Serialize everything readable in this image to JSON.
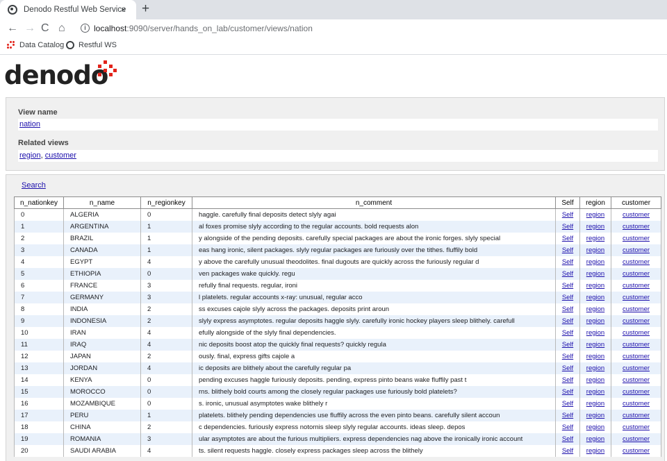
{
  "browser": {
    "tab_title": "Denodo Restful Web Service",
    "tab_close": "×",
    "new_tab": "+",
    "url_host": "localhost",
    "url_rest": ":9090/server/hands_on_lab/customer/views/nation",
    "bookmarks": [
      "Data Catalog",
      "Restful WS"
    ],
    "nav": {
      "back": "←",
      "forward": "→",
      "reload": "C",
      "home": "⌂",
      "info": "i"
    }
  },
  "logo": {
    "text": "denodo",
    "accent_color": "#e2231a"
  },
  "info": {
    "view_name_label": "View name",
    "view_name": "nation",
    "related_label": "Related views",
    "related": [
      "region",
      "customer"
    ],
    "related_sep": ", "
  },
  "search_label": "Search",
  "table": {
    "columns": [
      "n_nationkey",
      "n_name",
      "n_regionkey",
      "n_comment",
      "Self",
      "region",
      "customer"
    ],
    "rows": [
      [
        "0",
        "ALGERIA",
        "0",
        "haggle. carefully final deposits detect slyly agai"
      ],
      [
        "1",
        "ARGENTINA",
        "1",
        "al foxes promise slyly according to the regular accounts. bold requests alon"
      ],
      [
        "2",
        "BRAZIL",
        "1",
        "y alongside of the pending deposits. carefully special packages are about the ironic forges. slyly special"
      ],
      [
        "3",
        "CANADA",
        "1",
        "eas hang ironic, silent packages. slyly regular packages are furiously over the tithes. fluffily bold"
      ],
      [
        "4",
        "EGYPT",
        "4",
        "y above the carefully unusual theodolites. final dugouts are quickly across the furiously regular d"
      ],
      [
        "5",
        "ETHIOPIA",
        "0",
        "ven packages wake quickly. regu"
      ],
      [
        "6",
        "FRANCE",
        "3",
        "refully final requests. regular, ironi"
      ],
      [
        "7",
        "GERMANY",
        "3",
        "l platelets. regular accounts x-ray: unusual, regular acco"
      ],
      [
        "8",
        "INDIA",
        "2",
        "ss excuses cajole slyly across the packages. deposits print aroun"
      ],
      [
        "9",
        "INDONESIA",
        "2",
        "slyly express asymptotes. regular deposits haggle slyly. carefully ironic hockey players sleep blithely. carefull"
      ],
      [
        "10",
        "IRAN",
        "4",
        "efully alongside of the slyly final dependencies."
      ],
      [
        "11",
        "IRAQ",
        "4",
        "nic deposits boost atop the quickly final requests? quickly regula"
      ],
      [
        "12",
        "JAPAN",
        "2",
        "ously. final, express gifts cajole a"
      ],
      [
        "13",
        "JORDAN",
        "4",
        "ic deposits are blithely about the carefully regular pa"
      ],
      [
        "14",
        "KENYA",
        "0",
        "pending excuses haggle furiously deposits. pending, express pinto beans wake fluffily past t"
      ],
      [
        "15",
        "MOROCCO",
        "0",
        "rns. blithely bold courts among the closely regular packages use furiously bold platelets?"
      ],
      [
        "16",
        "MOZAMBIQUE",
        "0",
        "s. ironic, unusual asymptotes wake blithely r"
      ],
      [
        "17",
        "PERU",
        "1",
        "platelets. blithely pending dependencies use fluffily across the even pinto beans. carefully silent accoun"
      ],
      [
        "18",
        "CHINA",
        "2",
        "c dependencies. furiously express notornis sleep slyly regular accounts. ideas sleep. depos"
      ],
      [
        "19",
        "ROMANIA",
        "3",
        "ular asymptotes are about the furious multipliers. express dependencies nag above the ironically ironic account"
      ],
      [
        "20",
        "SAUDI ARABIA",
        "4",
        "ts. silent requests haggle. closely express packages sleep across the blithely"
      ]
    ],
    "link_labels": [
      "Self",
      "region",
      "customer"
    ]
  }
}
